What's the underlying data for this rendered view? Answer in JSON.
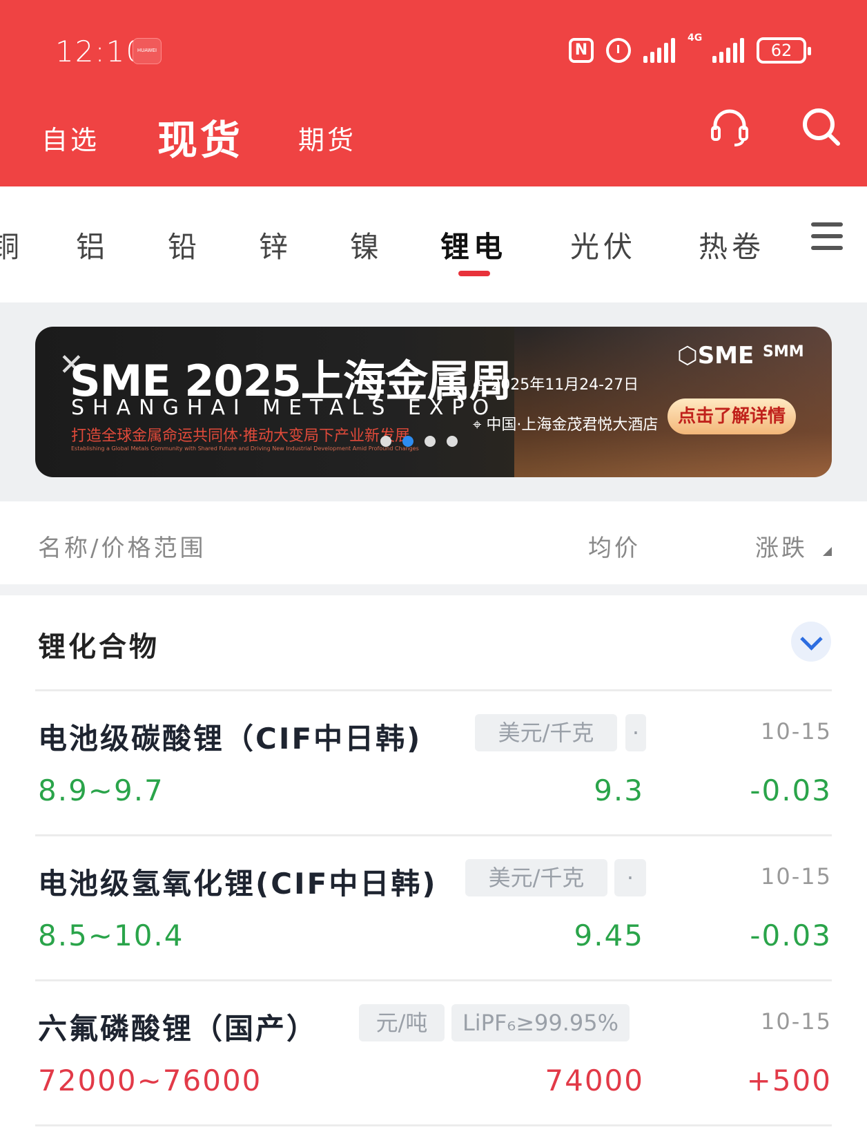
{
  "status": {
    "time": "12:10",
    "huawei_badge": "HUAWEI",
    "nfc": "N",
    "network": "4G",
    "battery": "62"
  },
  "top_tabs": [
    "自选",
    "现货",
    "期货"
  ],
  "categories": [
    "铜",
    "铝",
    "铅",
    "锌",
    "镍",
    "锂电",
    "光伏",
    "热卷"
  ],
  "banner": {
    "title": "SME 2025上海金属周",
    "subtitle": "SHANGHAI METALS EXPO",
    "slogan": "打造全球金属命运共同体·推动大变局下产业新发展",
    "slogan_en": "Establishing a Global Metals Community with Shared Future and Driving New Industrial Development Amid Profound Changes",
    "date": "2025年11月24-27日",
    "venue": "中国·上海金茂君悦大酒店",
    "logo": "SME",
    "logo2": "SMM",
    "cta": "点击了解详情",
    "active_dot": 1
  },
  "columns": {
    "name": "名称/价格范围",
    "avg": "均价",
    "change": "涨跌"
  },
  "section": {
    "title": "锂化合物"
  },
  "items": [
    {
      "name": "电池级碳酸锂（CIF中日韩)",
      "tags": [
        "美元/千克",
        "·"
      ],
      "date": "10-15",
      "range": "8.9~9.7",
      "avg": "9.3",
      "change": "-0.03",
      "direction": "down"
    },
    {
      "name": "电池级氢氧化锂(CIF中日韩)",
      "tags": [
        "美元/千克",
        "·"
      ],
      "date": "10-15",
      "range": "8.5~10.4",
      "avg": "9.45",
      "change": "-0.03",
      "direction": "down"
    },
    {
      "name": "六氟磷酸锂（国产）",
      "tags": [
        "元/吨",
        "LiPF₆≥99.95%"
      ],
      "date": "10-15",
      "range": "72000~76000",
      "avg": "74000",
      "change": "+500",
      "direction": "up"
    }
  ],
  "colors": {
    "header": "#ef4343",
    "down": "#2aa44a",
    "up": "#e23a48",
    "accent": "#e8323b",
    "dot_active": "#2d8cf0"
  }
}
